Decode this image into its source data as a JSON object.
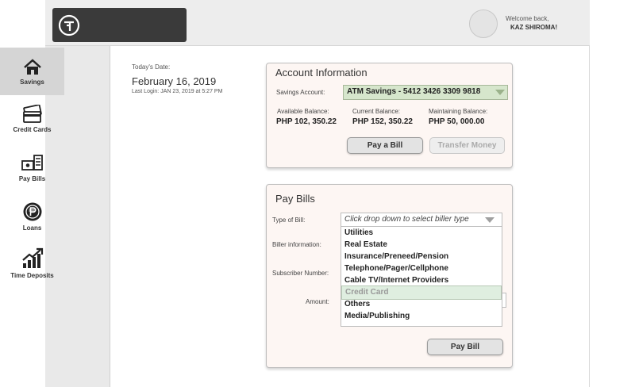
{
  "header": {
    "welcome_text": "Welcome back,",
    "user_name": "KAZ SHIROMA!"
  },
  "sidebar": {
    "items": [
      {
        "label": "Savings",
        "icon": "home-icon",
        "active": true
      },
      {
        "label": "Credit Cards",
        "icon": "credit-cards-icon",
        "active": false
      },
      {
        "label": "Pay Bills",
        "icon": "pay-bills-icon",
        "active": false
      },
      {
        "label": "Loans",
        "icon": "peso-coin-icon",
        "active": false
      },
      {
        "label": "Time Deposits",
        "icon": "growth-chart-icon",
        "active": false
      }
    ]
  },
  "date_info": {
    "label": "Today's Date:",
    "value": "February 16, 2019",
    "last_login": "Last Login: JAN 23, 2019 at 5:27 PM"
  },
  "account_panel": {
    "title": "Account Information",
    "savings_account_label": "Savings Account:",
    "savings_account_value": "ATM Savings - 5412 3426 3309 9818",
    "available_label": "Available Balance:",
    "available_value": "PHP 102, 350.22",
    "current_label": "Current Balance:",
    "current_value": "PHP 152, 350.22",
    "maintaining_label": "Maintaining Balance:",
    "maintaining_value": "PHP 50, 000.00",
    "pay_bill_button": "Pay a Bill",
    "transfer_button": "Transfer Money"
  },
  "pay_bills_panel": {
    "title": "Pay Bills",
    "type_label": "Type of Bill:",
    "biller_label": "Biller information:",
    "subscriber_label": "Subscriber Number:",
    "amount_label": "Amount:",
    "dropdown_placeholder": "Click drop down to select biller type",
    "options": [
      "Utilities",
      "Real Estate",
      "Insurance/Preneed/Pension",
      "Telephone/Pager/Cellphone",
      "Cable TV/Internet Providers",
      "Credit Card",
      "Others",
      "Media/Publishing"
    ],
    "highlighted_option": "Credit Card",
    "submit_button": "Pay Bill"
  },
  "colors": {
    "panel_bg": "#fdf6f3",
    "select_green": "#d6e6cc",
    "sidebar_bg": "#e9e9e9",
    "logo_bg": "#3a3a3a"
  }
}
